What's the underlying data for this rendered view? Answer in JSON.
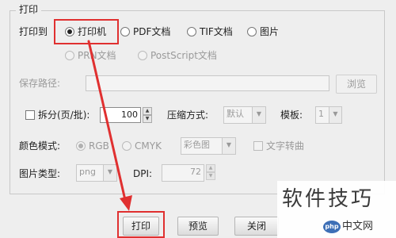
{
  "dialog": {
    "group_title": "打印",
    "print_to": {
      "label": "打印到",
      "options": [
        "打印机",
        "PDF文档",
        "TIF文档",
        "图片",
        "PRN文档",
        "PostScript文档"
      ],
      "selected": "打印机"
    },
    "save_path": {
      "label": "保存路径:",
      "value": "",
      "browse_label": "浏览"
    },
    "split": {
      "label": "拆分(页/批):",
      "value": "100",
      "checked": false
    },
    "compression": {
      "label": "压缩方式:",
      "value": "默认"
    },
    "template": {
      "label": "模板:",
      "value": "1"
    },
    "color_mode": {
      "label": "颜色模式:",
      "options": [
        "RGB",
        "CMYK"
      ],
      "selected": "RGB",
      "combo_value": "彩色图"
    },
    "text_to_curve": {
      "label": "文字转曲",
      "checked": false
    },
    "image_type": {
      "label": "图片类型:",
      "value": "png"
    },
    "dpi": {
      "label": "DPI:",
      "value": "72"
    },
    "buttons": {
      "print": "打印",
      "preview": "预览",
      "close": "关闭"
    }
  },
  "watermark": {
    "text": "软件技巧",
    "site": "中文网",
    "logo": "php"
  },
  "colors": {
    "annotation": "#e03030"
  }
}
